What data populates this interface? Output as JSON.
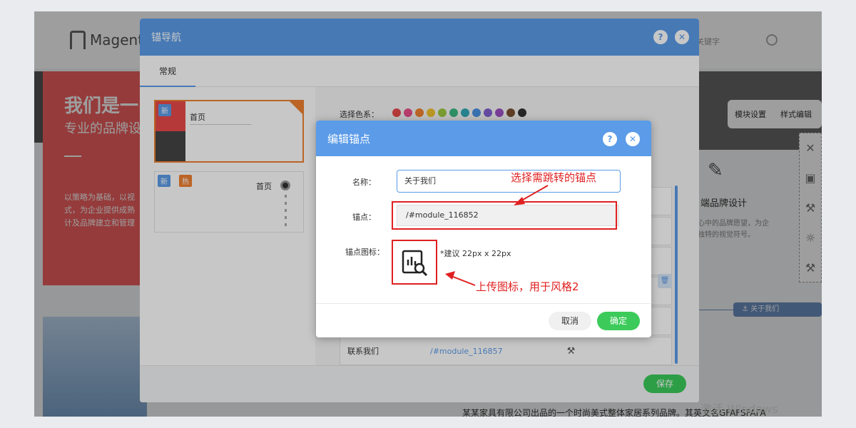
{
  "background_page": {
    "logo_text": "Magento",
    "search_placeholder": "关键字",
    "hero_title": "我们是一",
    "hero_subtitle": "专业的品牌设",
    "hero_text_lines": [
      "以策略为基础，以视",
      "式，为企业提供成熟",
      "计及品牌建立和管理"
    ],
    "module_settings": "模块设置",
    "style_edit": "样式编辑",
    "brand_design_title": "端品牌设计",
    "brand_design_text": [
      "心中的品牌愿望，为企",
      "独特的视觉符号。"
    ],
    "anchor_tag": "关于我们",
    "bottom_text": "某某家具有限公司出品的一个时尚美式整体家居系列品牌。其英文名GFAFSFAFA",
    "watermark": "激活 Windows"
  },
  "anchor_nav_modal": {
    "title": "锚导航",
    "tab_general": "常规",
    "style1_label": "首页",
    "style2_label": "首页",
    "badge_new": "新",
    "badge_hot": "热",
    "color_scheme_label": "选择色系：",
    "colors": [
      "#e84a4a",
      "#e8508a",
      "#f08030",
      "#f0c030",
      "#9bc840",
      "#3cb880",
      "#30a8b8",
      "#4a90e0",
      "#8060d0",
      "#9a50c0",
      "#7a5030",
      "#333333"
    ],
    "row_link_text": "联系我们",
    "row_link_anchor": "/#module_116857",
    "save": "保存"
  },
  "edit_anchor_dialog": {
    "title": "编辑锚点",
    "name_label": "名称：",
    "name_value": "关于我们",
    "anchor_label": "锚点：",
    "anchor_value": "/#module_116852",
    "icon_label": "锚点图标：",
    "icon_hint": "*建议 22px x 22px",
    "cancel": "取消",
    "confirm": "确定"
  },
  "annotations": {
    "select_anchor": "选择需跳转的锚点",
    "upload_icon": "上传图标，用于风格2"
  }
}
